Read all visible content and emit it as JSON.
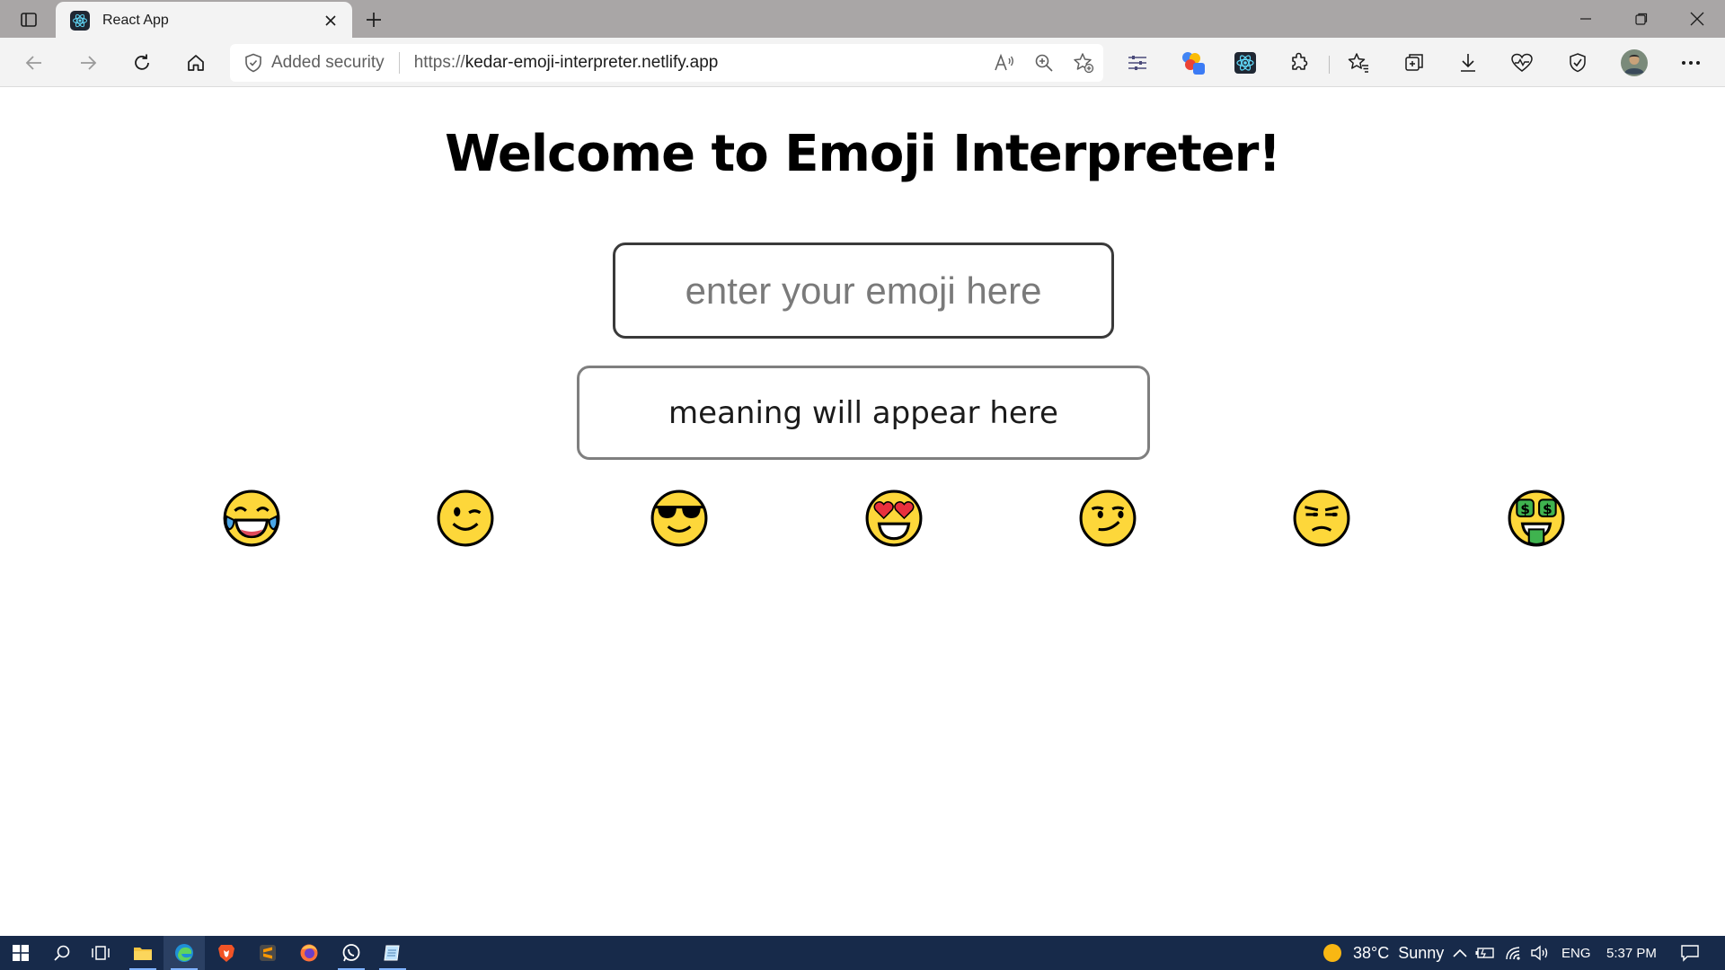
{
  "browser": {
    "tab": {
      "title": "React App"
    },
    "address": {
      "security_label": "Added security",
      "url_prefix": "https://",
      "url_host": "kedar-emoji-interpreter.netlify.app"
    }
  },
  "page": {
    "heading": "Welcome to Emoji Interpreter!",
    "input_placeholder": "enter your emoji here",
    "meaning_text": "meaning will appear here",
    "emojis": [
      {
        "name": "face-with-tears-of-joy"
      },
      {
        "name": "winking-face"
      },
      {
        "name": "smiling-face-with-sunglasses"
      },
      {
        "name": "smiling-face-with-heart-eyes"
      },
      {
        "name": "smirking-face"
      },
      {
        "name": "unamused-face"
      },
      {
        "name": "money-mouth-face"
      }
    ]
  },
  "taskbar": {
    "weather": {
      "temp": "38°C",
      "condition": "Sunny"
    },
    "language": "ENG",
    "time": "5:37 PM"
  },
  "colors": {
    "titlebar": "#a9a6a6",
    "toolbar": "#f3f3f3",
    "taskbar": "#172a4a",
    "emoji_yellow": "#fdd73a"
  }
}
